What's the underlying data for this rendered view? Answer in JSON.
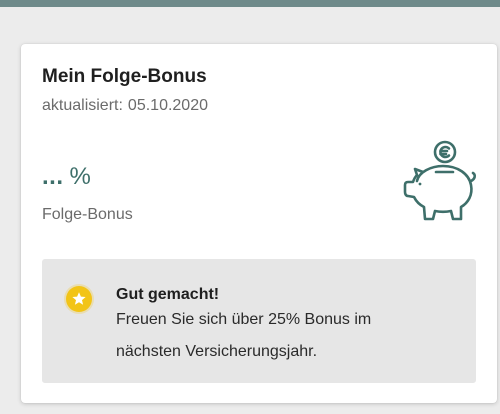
{
  "card": {
    "title": "Mein Folge-Bonus",
    "updated_label": "aktualisiert:",
    "updated_date": "05.10.2020"
  },
  "bonus": {
    "value": "...",
    "unit": "%",
    "label": "Folge-Bonus",
    "icon": "piggy-bank-euro-icon"
  },
  "info": {
    "icon": "star-icon",
    "title": "Gut gemacht!",
    "line1": "Freuen Sie sich über 25% Bonus im",
    "line2": "nächsten Versicherungsjahr."
  },
  "colors": {
    "accent": "#3e6f6a",
    "star": "#f2c417",
    "info_bg": "#e6e6e6",
    "top_strip": "#6f8a8a"
  }
}
